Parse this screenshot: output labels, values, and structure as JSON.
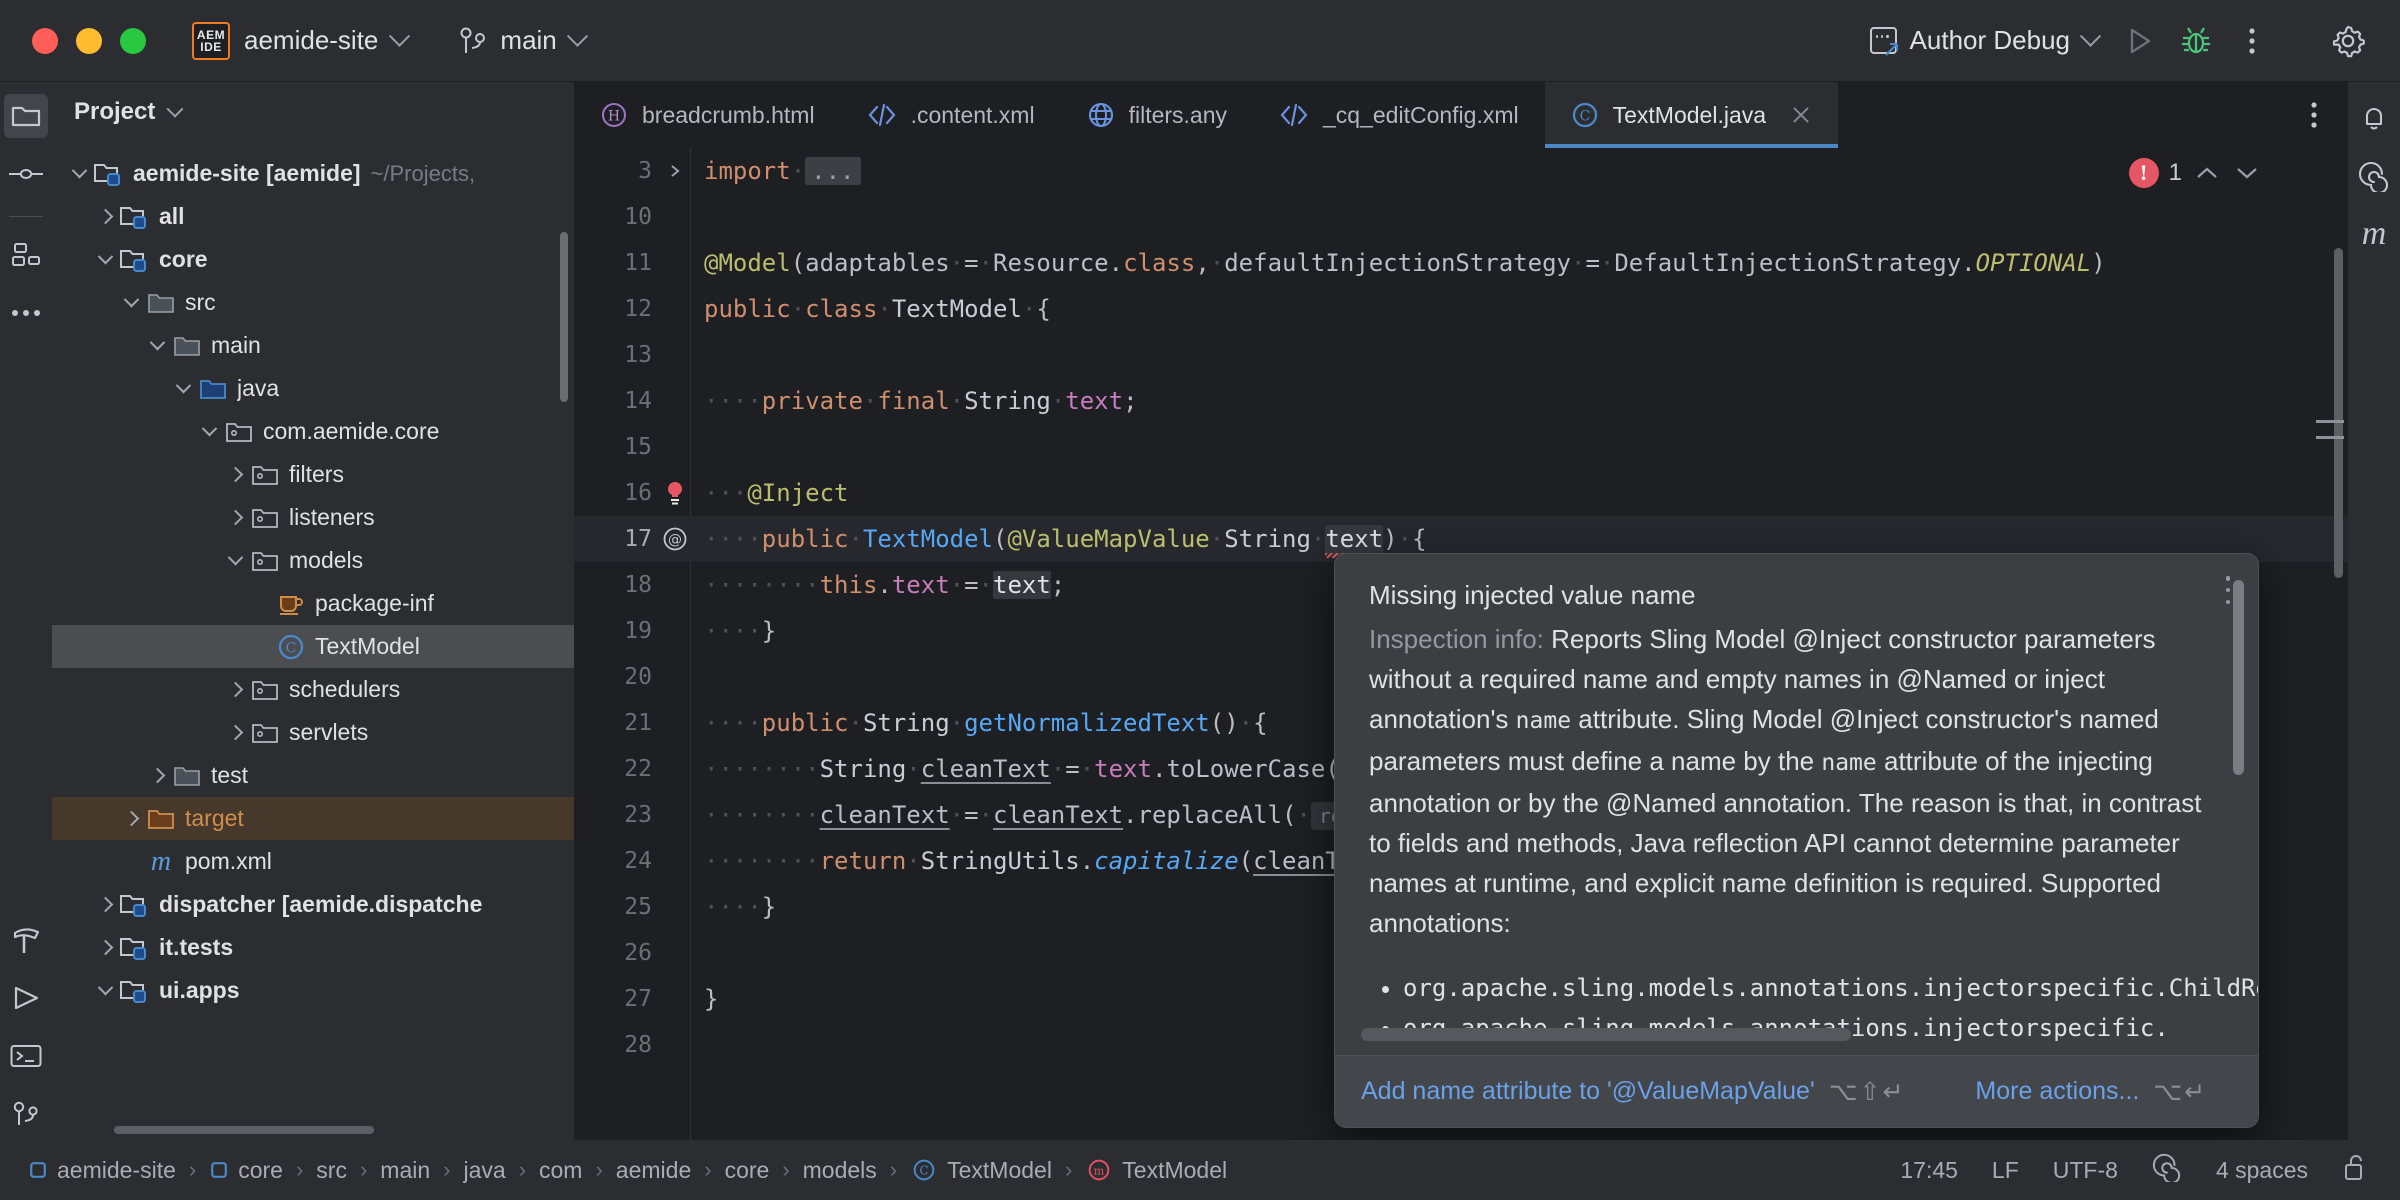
{
  "titlebar": {
    "project_name": "aemide-site",
    "branch": "main",
    "run_config": "Author Debug",
    "logo_line1": "AEM",
    "logo_line2": "IDE"
  },
  "left_rail": {
    "items": [
      {
        "name": "project",
        "icon": "folder-icon",
        "active": true
      },
      {
        "name": "commit",
        "icon": "commit-icon",
        "active": false
      },
      {
        "name": "structure",
        "icon": "structure-icon",
        "active": false
      },
      {
        "name": "more",
        "icon": "more-tools-icon",
        "active": false
      }
    ],
    "bottom_items": [
      {
        "name": "build",
        "icon": "hammer-icon"
      },
      {
        "name": "run",
        "icon": "run-triangle-icon"
      },
      {
        "name": "terminal",
        "icon": "terminal-icon"
      },
      {
        "name": "version-control",
        "icon": "branch-icon"
      }
    ]
  },
  "right_rail": {
    "items": [
      {
        "name": "notifications",
        "icon": "bell-icon"
      },
      {
        "name": "ai-assistant",
        "icon": "spiral-icon"
      },
      {
        "name": "maven",
        "icon": "maven-m-icon"
      }
    ]
  },
  "project_panel": {
    "title": "Project",
    "tree": [
      {
        "depth": 0,
        "twisty": "down",
        "icon": "module-folder-icon",
        "label": "aemide-site [aemide]",
        "bold": true,
        "path": "~/Projects,",
        "state": "normal"
      },
      {
        "depth": 1,
        "twisty": "right",
        "icon": "module-folder-icon",
        "label": "all",
        "bold": true,
        "state": "normal"
      },
      {
        "depth": 1,
        "twisty": "down",
        "icon": "module-folder-icon",
        "label": "core",
        "bold": true,
        "state": "normal"
      },
      {
        "depth": 2,
        "twisty": "down",
        "icon": "folder-icon",
        "label": "src",
        "state": "normal"
      },
      {
        "depth": 3,
        "twisty": "down",
        "icon": "folder-icon",
        "label": "main",
        "state": "normal"
      },
      {
        "depth": 4,
        "twisty": "down",
        "icon": "source-folder-icon",
        "label": "java",
        "state": "normal"
      },
      {
        "depth": 5,
        "twisty": "down",
        "icon": "package-icon",
        "label": "com.aemide.core",
        "state": "normal"
      },
      {
        "depth": 6,
        "twisty": "right",
        "icon": "package-icon",
        "label": "filters",
        "state": "normal"
      },
      {
        "depth": 6,
        "twisty": "right",
        "icon": "package-icon",
        "label": "listeners",
        "state": "normal"
      },
      {
        "depth": 6,
        "twisty": "down",
        "icon": "package-icon",
        "label": "models",
        "state": "normal"
      },
      {
        "depth": 7,
        "twisty": "none",
        "icon": "java-cup-icon",
        "label": "package-inf",
        "state": "normal"
      },
      {
        "depth": 7,
        "twisty": "none",
        "icon": "class-icon",
        "label": "TextModel",
        "state": "selected"
      },
      {
        "depth": 6,
        "twisty": "right",
        "icon": "package-icon",
        "label": "schedulers",
        "state": "normal"
      },
      {
        "depth": 6,
        "twisty": "right",
        "icon": "package-icon",
        "label": "servlets",
        "state": "normal"
      },
      {
        "depth": 3,
        "twisty": "right",
        "icon": "folder-icon",
        "label": "test",
        "state": "normal"
      },
      {
        "depth": 2,
        "twisty": "right",
        "icon": "excluded-folder-icon",
        "label": "target",
        "state": "excluded"
      },
      {
        "depth": 2,
        "twisty": "none",
        "icon": "maven-m-icon",
        "label": "pom.xml",
        "state": "normal"
      },
      {
        "depth": 1,
        "twisty": "right",
        "icon": "module-folder-icon",
        "label": "dispatcher [aemide.dispatche",
        "bold": true,
        "state": "normal"
      },
      {
        "depth": 1,
        "twisty": "right",
        "icon": "module-folder-icon",
        "label": "it.tests",
        "bold": true,
        "state": "normal"
      },
      {
        "depth": 1,
        "twisty": "down",
        "icon": "module-folder-icon",
        "label": "ui.apps",
        "bold": true,
        "state": "normal"
      }
    ]
  },
  "editor": {
    "tabs": [
      {
        "label": "breadcrumb.html",
        "icon": "html-icon",
        "active": false
      },
      {
        "label": ".content.xml",
        "icon": "xml-icon",
        "active": false
      },
      {
        "label": "filters.any",
        "icon": "globe-icon",
        "active": false
      },
      {
        "label": "_cq_editConfig.xml",
        "icon": "xml-icon",
        "active": false
      },
      {
        "label": "TextModel.java",
        "icon": "class-icon",
        "active": true
      }
    ],
    "error_count": "1",
    "lines": [
      {
        "num": "3",
        "folded": true
      },
      {
        "num": "10"
      },
      {
        "num": "11"
      },
      {
        "num": "12"
      },
      {
        "num": "13"
      },
      {
        "num": "14"
      },
      {
        "num": "15"
      },
      {
        "num": "16",
        "gutter": "bulb-error-icon"
      },
      {
        "num": "17",
        "gutter": "annotation-at-icon",
        "current": true
      },
      {
        "num": "18"
      },
      {
        "num": "19"
      },
      {
        "num": "20"
      },
      {
        "num": "21"
      },
      {
        "num": "22"
      },
      {
        "num": "23"
      },
      {
        "num": "24"
      },
      {
        "num": "25"
      },
      {
        "num": "26"
      },
      {
        "num": "27"
      },
      {
        "num": "28"
      }
    ],
    "code": {
      "l3_import": "import",
      "l3_fold": "...",
      "l11": "@Model(adaptables = Resource.class, defaultInjectionStrategy = DefaultInjectionStrategy.OPTIONAL)",
      "l12": "public class TextModel {",
      "l14": "private final String text;",
      "l16": "@Inject",
      "l17": "public TextModel(@ValueMapValue String text) {",
      "l18": "this.text = text;",
      "l19": "}",
      "l21": "public String getNormalizedText() {",
      "l22": "String cleanText = text.toLowerCase(",
      "l23": "cleanText = cleanText.replaceAll(",
      "l23_hint": "reg",
      "l24": "return StringUtils.capitalize(cleanT",
      "l25": "}",
      "l27": "}"
    }
  },
  "popup": {
    "title": "Missing injected value name",
    "inspection_label": "Inspection info:",
    "para1": "Reports Sling Model @Inject constructor parameters without a required name and empty names in @Named or inject annotation's",
    "para1_mono": "name",
    "para1_tail": "attribute.",
    "para2a": "Sling Model @Inject constructor's named parameters must define a name by the",
    "para2_mono": "name",
    "para2b": "attribute of the injecting annotation or by the @Named annotation. The reason is that, in contrast to fields and methods, Java reflection API cannot determine parameter names at runtime, and explicit name definition is required. Supported annotations:",
    "bullets": [
      "org.apache.sling.models.annotations.injectorspecific.ChildResource",
      "org.apache.sling.models.annotations.injectorspecific."
    ],
    "action_primary": "Add name attribute to '@ValueMapValue'",
    "action_primary_keys": "⌥⇧↵",
    "action_secondary": "More actions...",
    "action_secondary_keys": "⌥↵"
  },
  "statusbar": {
    "breadcrumbs": [
      {
        "label": "aemide-site",
        "icon": "module-square-icon"
      },
      {
        "label": "core",
        "icon": "module-square-icon"
      },
      {
        "label": "src",
        "icon": "none"
      },
      {
        "label": "main",
        "icon": "none"
      },
      {
        "label": "java",
        "icon": "none"
      },
      {
        "label": "com",
        "icon": "none"
      },
      {
        "label": "aemide",
        "icon": "none"
      },
      {
        "label": "core",
        "icon": "none"
      },
      {
        "label": "models",
        "icon": "none"
      },
      {
        "label": "TextModel",
        "icon": "class-icon"
      },
      {
        "label": "TextModel",
        "icon": "method-icon"
      }
    ],
    "separator": "›",
    "time": "17:45",
    "line_sep": "LF",
    "encoding": "UTF-8",
    "ai_icon": "spiral-icon",
    "indent": "4 spaces",
    "lock_icon": "unlocked-icon"
  },
  "colors": {
    "accent": "#4a88c7",
    "error": "#e55765",
    "excluded": "#cf8e4e",
    "link": "#6ba1e8"
  }
}
